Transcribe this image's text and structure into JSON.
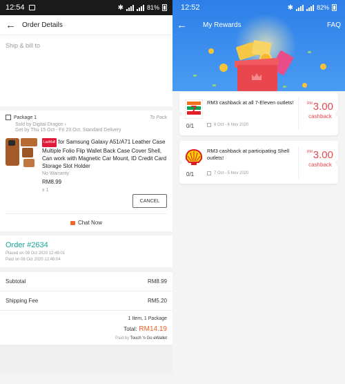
{
  "left": {
    "status_bar": {
      "time": "12:54",
      "battery": "81%"
    },
    "header": {
      "title": "Order Details"
    },
    "ship": {
      "label": "Ship & bill to"
    },
    "package": {
      "title": "Package 1",
      "status": "To Pack",
      "sold_by": "Sold by Digital Dragon",
      "get_by": "Get by Thu 15 Oct - Fri 23 Oct, Standard Delivery",
      "item": {
        "badge": "LazMall",
        "name": "for Samsung Galaxy A51/A71 Leather Case Multiple Folio Flip Wallet Back Case Cover Shell, Can work with Magnetic Car Mount, ID Credit Card Storage Slot Holder",
        "warranty": "No Warranty",
        "price": "RM8.99",
        "qty": "x 1"
      },
      "cancel_label": "CANCEL",
      "chat_label": "Chat Now"
    },
    "order": {
      "number": "Order #2634",
      "placed": "Placed on 08 Oct 2020  12:48:01",
      "paid": "Paid on 08 Oct 2020  12:48:04"
    },
    "summary": {
      "subtotal_label": "Subtotal",
      "subtotal": "RM8.99",
      "shipping_label": "Shipping Fee",
      "shipping": "RM5.20",
      "count": "1 Item, 1 Package",
      "total_label": "Total:",
      "total": "RM14.19",
      "paid_by_prefix": "Paid by",
      "paid_by": "Touch 'n Go eWallet"
    }
  },
  "right": {
    "status_bar": {
      "time": "12:52",
      "battery": "82%"
    },
    "header": {
      "title": "My Rewards",
      "faq": "FAQ"
    },
    "rewards": [
      {
        "logo": "seven-eleven-logo",
        "text": "RM3 cashback at all 7-Eleven outlets!",
        "progress": "0/1",
        "dates": "8 Oct - 6 Nov 2020",
        "currency": "RM",
        "amount": "3.00",
        "label": "cashback"
      },
      {
        "logo": "shell-logo",
        "text": "RM3 cashback at participating Shell outlets!",
        "progress": "0/1",
        "dates": "7 Oct - 5 Nov 2020",
        "currency": "RM",
        "amount": "3.00",
        "label": "cashback"
      }
    ]
  },
  "colors": {
    "teal": "#1aa39a",
    "orange": "#f15a22",
    "reward_red": "#e8474d",
    "header_blue": "#2d7fe8"
  }
}
